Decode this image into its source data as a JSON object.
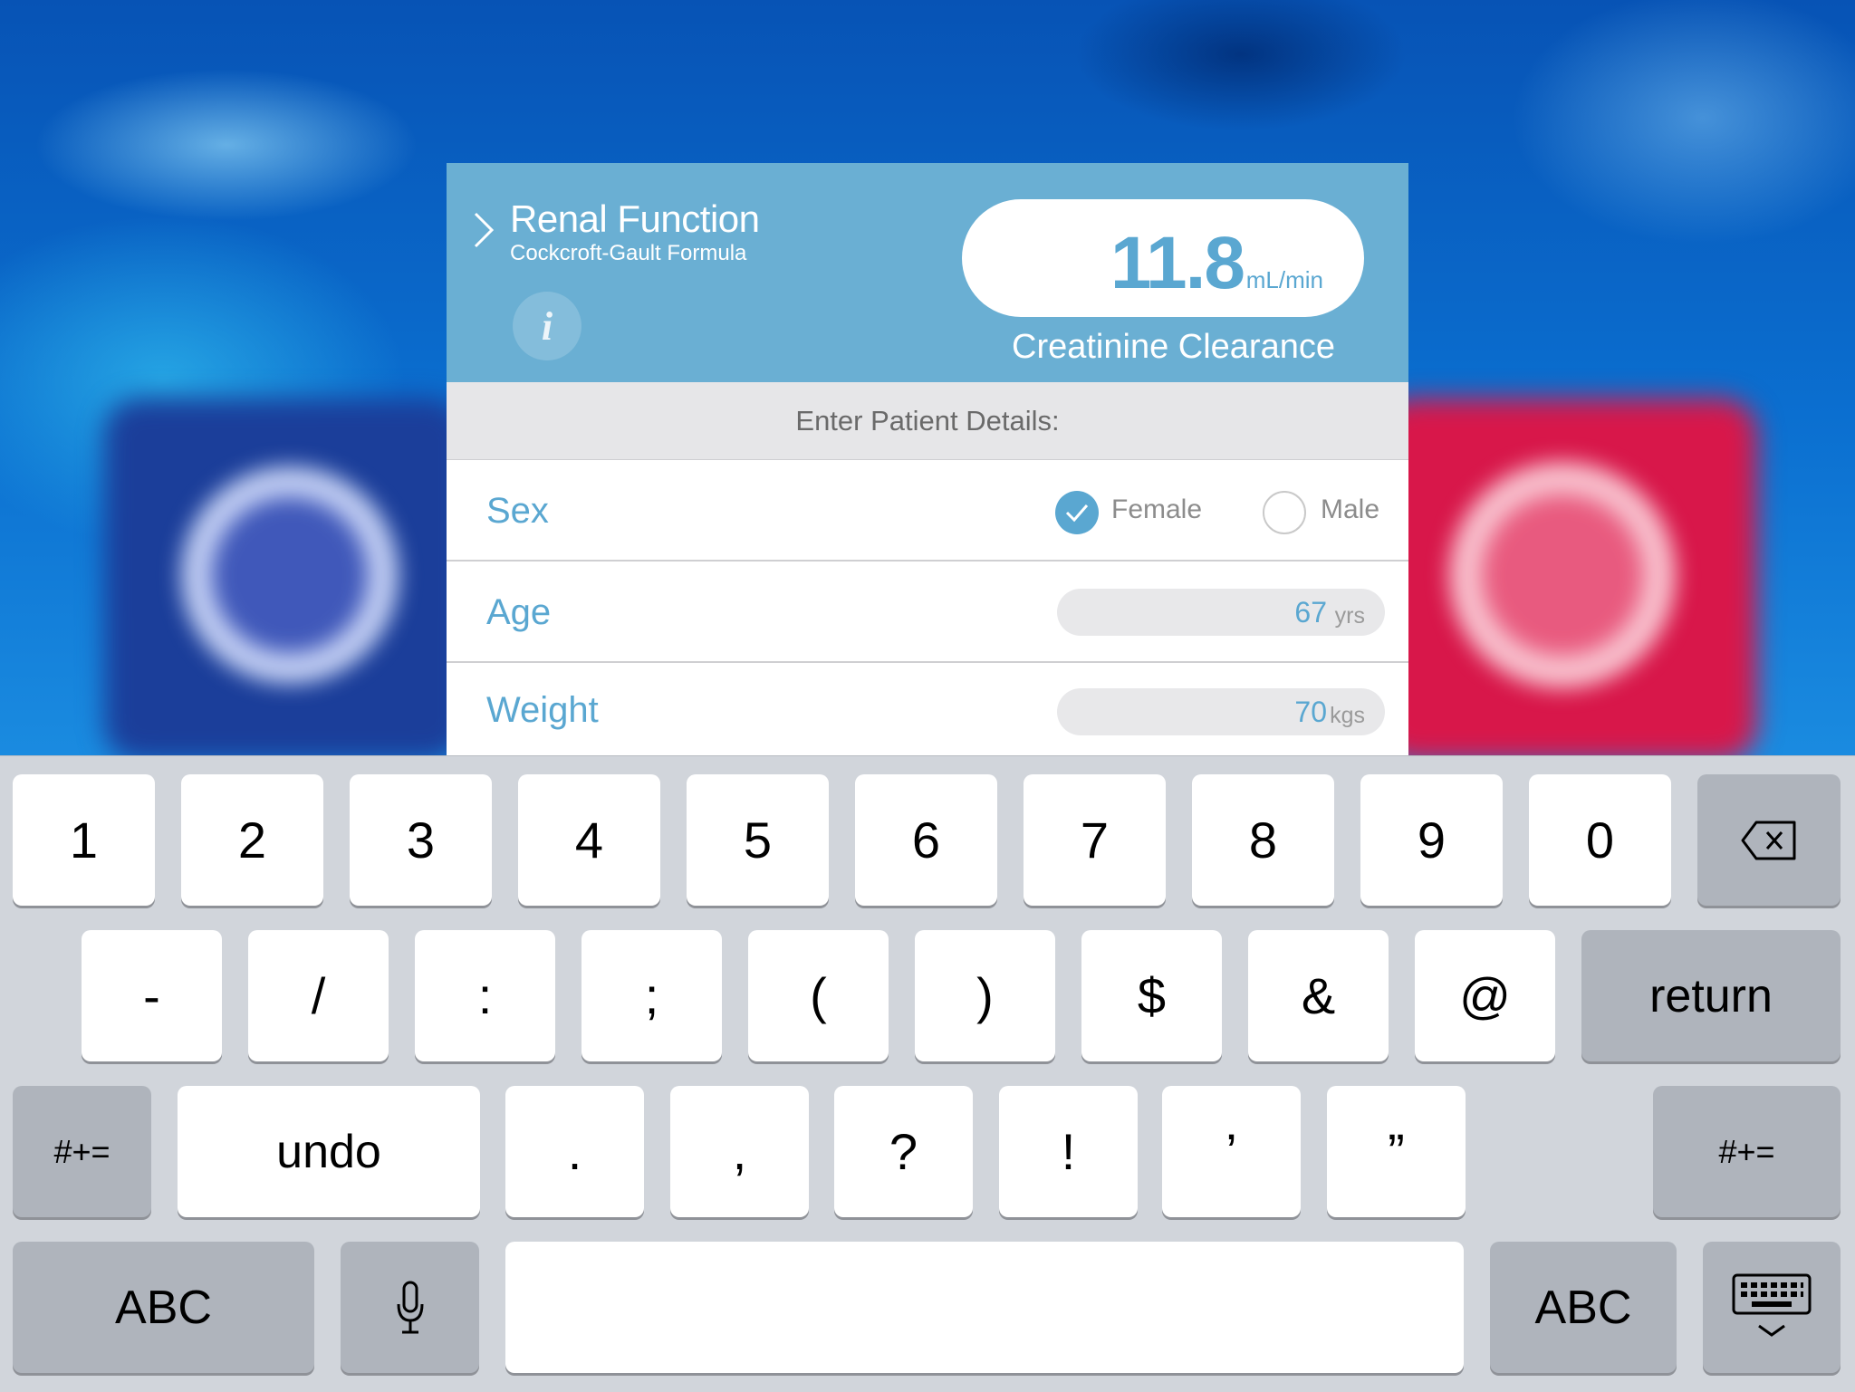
{
  "header": {
    "title": "Renal Function",
    "subtitle": "Cockcroft-Gault Formula",
    "info_glyph": "i",
    "result_value": "11.8",
    "result_unit": "mL/min",
    "result_label": "Creatinine Clearance"
  },
  "section": {
    "title": "Enter Patient Details:"
  },
  "fields": {
    "sex": {
      "label": "Sex",
      "options": [
        "Female",
        "Male"
      ],
      "selected": "Female"
    },
    "age": {
      "label": "Age",
      "value": "67",
      "unit": "yrs"
    },
    "weight": {
      "label": "Weight",
      "value": "70",
      "unit": "kgs"
    }
  },
  "colors": {
    "accent": "#5aa7d1",
    "header_bg": "#6aafd3",
    "keyboard_bg": "#d1d5db"
  },
  "keyboard": {
    "row1": [
      "1",
      "2",
      "3",
      "4",
      "5",
      "6",
      "7",
      "8",
      "9",
      "0"
    ],
    "row2": [
      "-",
      "/",
      ":",
      ";",
      "(",
      ")",
      "$",
      "&",
      "@"
    ],
    "return": "return",
    "shift_left": "#+=",
    "undo": "undo",
    "row3": [
      ".",
      ",",
      "?",
      "!",
      "’",
      "”"
    ],
    "shift_right": "#+=",
    "abc_left": "ABC",
    "abc_right": "ABC",
    "icons": [
      "backspace-icon",
      "microphone-icon",
      "keyboard-dismiss-icon"
    ]
  }
}
